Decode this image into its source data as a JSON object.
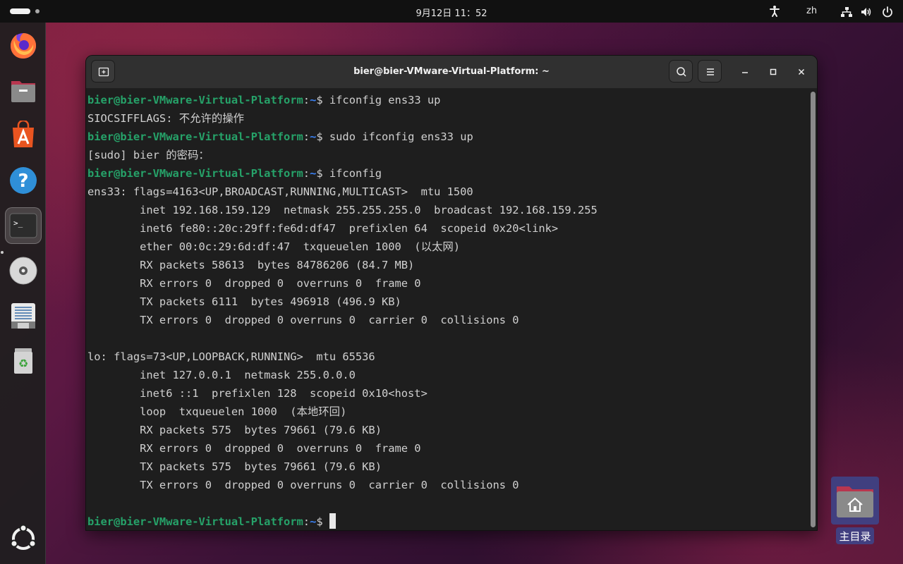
{
  "topbar": {
    "clock": "9月12日  11：52",
    "language": "zh"
  },
  "dock": {
    "items": [
      {
        "name": "firefox-icon"
      },
      {
        "name": "files-icon"
      },
      {
        "name": "app-center-icon"
      },
      {
        "name": "help-icon"
      },
      {
        "name": "terminal-icon",
        "active": true
      },
      {
        "name": "disc-icon"
      },
      {
        "name": "text-editor-icon"
      },
      {
        "name": "trash-icon"
      },
      {
        "name": "show-apps-icon"
      }
    ]
  },
  "window": {
    "title": "bier@bier-VMware-Virtual-Platform: ~"
  },
  "terminal": {
    "prompt_user": "bier@bier-VMware-Virtual-Platform",
    "prompt_path": "~",
    "lines": [
      {
        "prompt": true,
        "cmd": "ifconfig ens33 up"
      },
      {
        "text": "SIOCSIFFLAGS: 不允许的操作"
      },
      {
        "prompt": true,
        "cmd": "sudo ifconfig ens33 up"
      },
      {
        "text": "[sudo] bier 的密码："
      },
      {
        "prompt": true,
        "cmd": "ifconfig"
      },
      {
        "text": "ens33: flags=4163<UP,BROADCAST,RUNNING,MULTICAST>  mtu 1500"
      },
      {
        "text": "        inet 192.168.159.129  netmask 255.255.255.0  broadcast 192.168.159.255"
      },
      {
        "text": "        inet6 fe80::20c:29ff:fe6d:df47  prefixlen 64  scopeid 0x20<link>"
      },
      {
        "text": "        ether 00:0c:29:6d:df:47  txqueuelen 1000  (以太网)"
      },
      {
        "text": "        RX packets 58613  bytes 84786206 (84.7 MB)"
      },
      {
        "text": "        RX errors 0  dropped 0  overruns 0  frame 0"
      },
      {
        "text": "        TX packets 6111  bytes 496918 (496.9 KB)"
      },
      {
        "text": "        TX errors 0  dropped 0 overruns 0  carrier 0  collisions 0"
      },
      {
        "text": ""
      },
      {
        "text": "lo: flags=73<UP,LOOPBACK,RUNNING>  mtu 65536"
      },
      {
        "text": "        inet 127.0.0.1  netmask 255.0.0.0"
      },
      {
        "text": "        inet6 ::1  prefixlen 128  scopeid 0x10<host>"
      },
      {
        "text": "        loop  txqueuelen 1000  (本地环回)"
      },
      {
        "text": "        RX packets 575  bytes 79661 (79.6 KB)"
      },
      {
        "text": "        RX errors 0  dropped 0  overruns 0  frame 0"
      },
      {
        "text": "        TX packets 575  bytes 79661 (79.6 KB)"
      },
      {
        "text": "        TX errors 0  dropped 0 overruns 0  carrier 0  collisions 0"
      },
      {
        "text": ""
      },
      {
        "prompt": true,
        "cmd": "",
        "cursor": true
      }
    ]
  },
  "desktop": {
    "home_label": "主目录"
  }
}
